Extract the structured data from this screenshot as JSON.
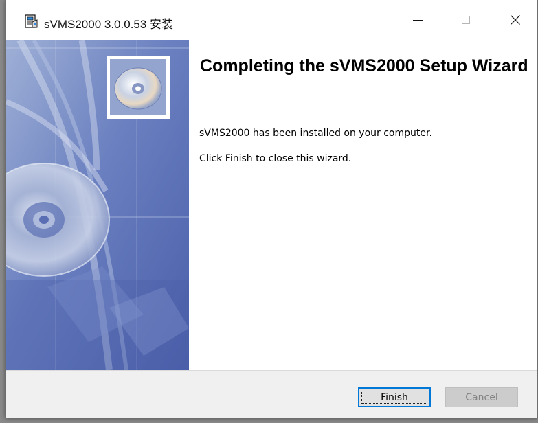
{
  "window": {
    "title": "sVMS2000 3.0.0.53 安装",
    "controls": {
      "minimize_icon": "minimize-icon",
      "maximize_icon": "maximize-icon",
      "close_icon": "close-icon"
    }
  },
  "wizard": {
    "heading": "Completing the sVMS2000 Setup Wizard",
    "message_installed": "sVMS2000 has been installed on your computer.",
    "message_finish": "Click Finish to close this wizard."
  },
  "buttons": {
    "finish_label": "Finish",
    "cancel_label": "Cancel"
  },
  "colors": {
    "accent": "#0078d7",
    "banner": "#5a6fb3",
    "footer": "#f0f0f0"
  }
}
